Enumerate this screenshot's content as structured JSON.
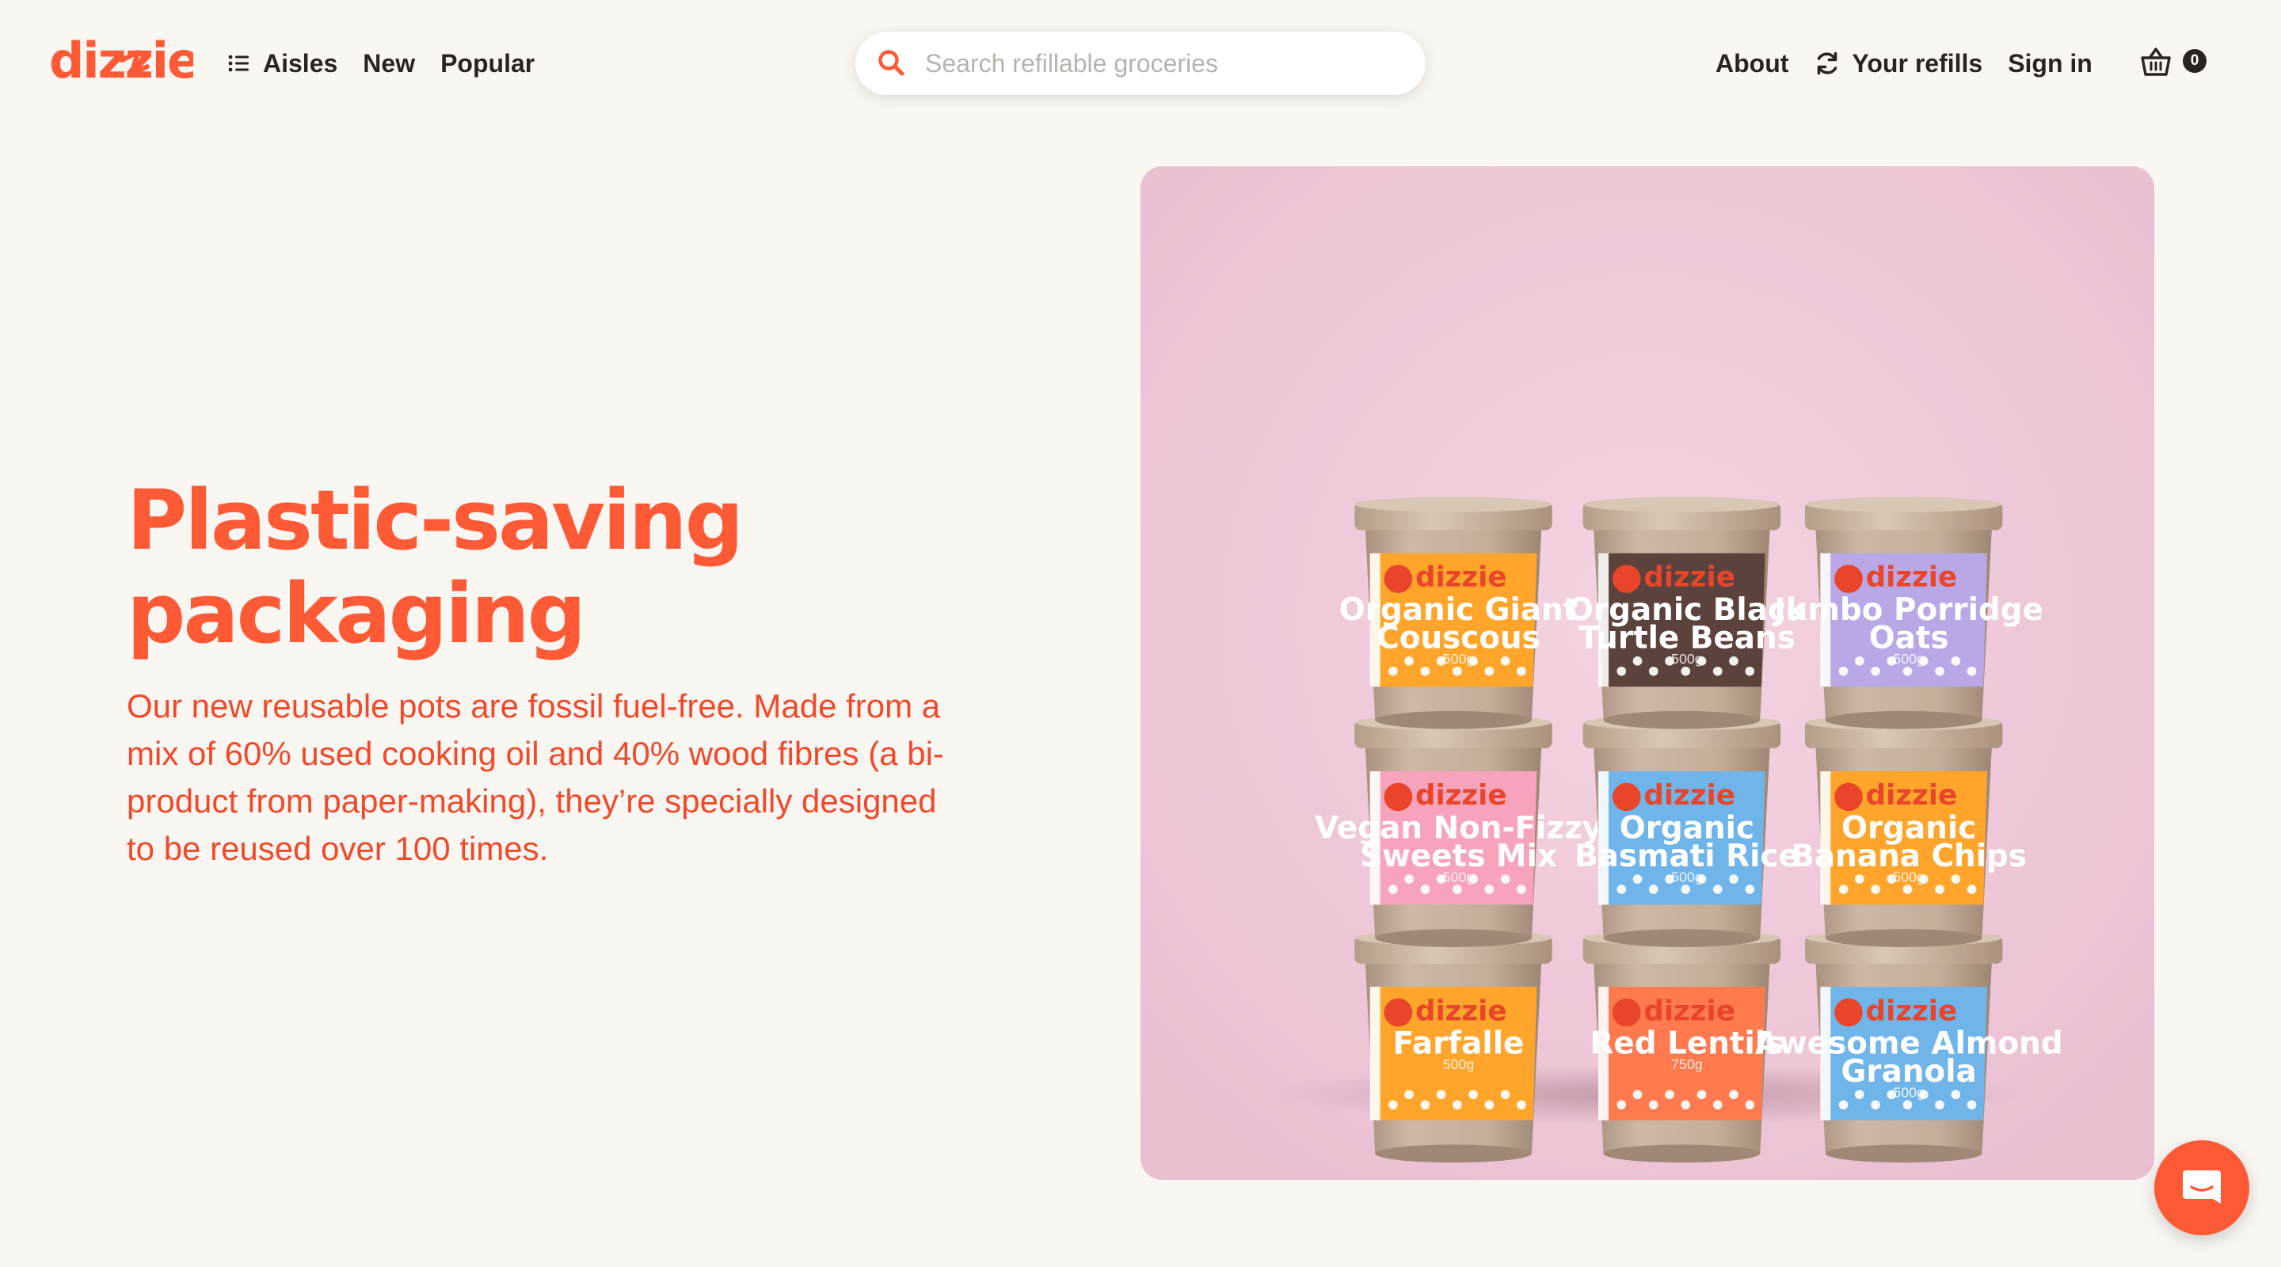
{
  "brand": {
    "name": "dizzie",
    "color": "#ff5a36"
  },
  "nav": {
    "aisles_label": "Aisles",
    "aisles_icon": "list-icon",
    "new_label": "New",
    "popular_label": "Popular"
  },
  "search": {
    "placeholder": "Search refillable groceries",
    "value": "",
    "icon": "search-icon"
  },
  "nav_right": {
    "about_label": "About",
    "refills_label": "Your refills",
    "refills_icon": "refresh-icon",
    "signin_label": "Sign in",
    "basket_icon": "basket-icon",
    "basket_count": "0"
  },
  "hero": {
    "title_line1": "Plastic-saving",
    "title_line2": "packaging",
    "body": "Our new reusable pots are fossil fuel-free. Made from a mix of 60% used cooking oil and 40% wood fibres (a bi-product from paper-making), they’re specially designed to be reused over 100 times."
  },
  "products": [
    {
      "brand": "dizzie",
      "name_line1": "Organic Giant",
      "name_line2": "Couscous",
      "weight": "500g",
      "color": "#ffa52c"
    },
    {
      "brand": "dizzie",
      "name_line1": "Organic Black",
      "name_line2": "Turtle Beans",
      "weight": "500g",
      "color": "#5b423c"
    },
    {
      "brand": "dizzie",
      "name_line1": "Jumbo Porridge",
      "name_line2": "Oats",
      "weight": "500g",
      "color": "#b9a7e6"
    },
    {
      "brand": "dizzie",
      "name_line1": "Vegan Non-Fizzy",
      "name_line2": "Sweets Mix",
      "weight": "500g",
      "color": "#f7a3bb"
    },
    {
      "brand": "dizzie",
      "name_line1": "Organic",
      "name_line2": "Basmati Rice",
      "weight": "500g",
      "color": "#6fb5ea"
    },
    {
      "brand": "dizzie",
      "name_line1": "Organic",
      "name_line2": "Banana Chips",
      "weight": "500g",
      "color": "#ffa52c"
    },
    {
      "brand": "dizzie",
      "name_line1": "Farfalle",
      "name_line2": "",
      "weight": "500g",
      "color": "#ffa52c"
    },
    {
      "brand": "dizzie",
      "name_line1": "Red Lentils",
      "name_line2": "",
      "weight": "750g",
      "color": "#ff7a4f"
    },
    {
      "brand": "dizzie",
      "name_line1": "Awesome Almond",
      "name_line2": "Granola",
      "weight": "500g",
      "color": "#6fb5ea"
    }
  ],
  "chat": {
    "icon": "chat-icon"
  },
  "colors": {
    "background": "#faf7f3",
    "accent": "#ff5a36",
    "photo_bg": "#efc9da",
    "pot": "#c9b4a2"
  }
}
